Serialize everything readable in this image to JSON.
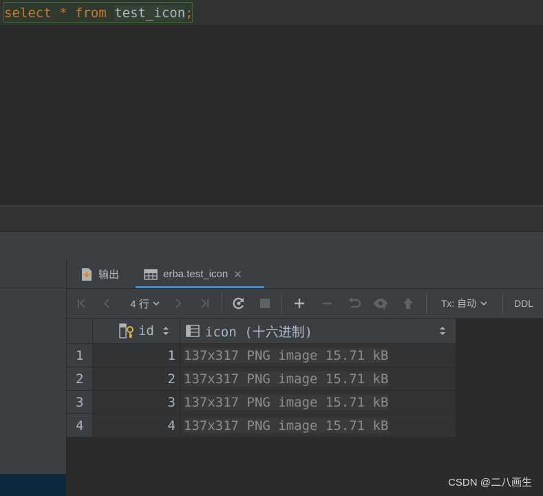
{
  "editor": {
    "kw_select": "select",
    "star": "*",
    "kw_from": "from",
    "table": "test_icon",
    "semicolon": ";"
  },
  "tabs": {
    "output_label": "输出",
    "table_label": "erba.test_icon",
    "close": "✕"
  },
  "toolbar": {
    "row_count": "4 行",
    "tx_label": "Tx: 自动",
    "ddl_label": "DDL"
  },
  "grid": {
    "columns": [
      "id",
      "icon (十六进制)"
    ],
    "rows": [
      {
        "num": "1",
        "id": "1",
        "icon": "137x317 PNG image 15.71 kB"
      },
      {
        "num": "2",
        "id": "2",
        "icon": "137x317 PNG image 15.71 kB"
      },
      {
        "num": "3",
        "id": "3",
        "icon": "137x317 PNG image 15.71 kB"
      },
      {
        "num": "4",
        "id": "4",
        "icon": "137x317 PNG image 15.71 kB"
      }
    ]
  },
  "watermark": "CSDN @二八画生",
  "colors": {
    "keyword": "#cc7832",
    "identifier": "#a9b7c6",
    "accent": "#4a88c7"
  }
}
